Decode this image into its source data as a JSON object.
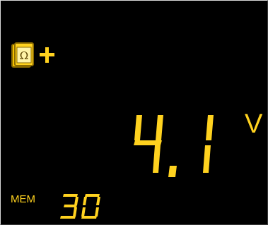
{
  "display": {
    "reading_value": "4.1",
    "reading_unit": "V",
    "mem_label": "MEM",
    "mem_value": "30",
    "status_icons": [
      "ohm-book-icon",
      "plus-icon"
    ]
  },
  "colors": {
    "background": "#000000",
    "segment": "#ffd21f",
    "icon_fill": "#f5c200",
    "icon_stroke": "#8a6a00"
  }
}
